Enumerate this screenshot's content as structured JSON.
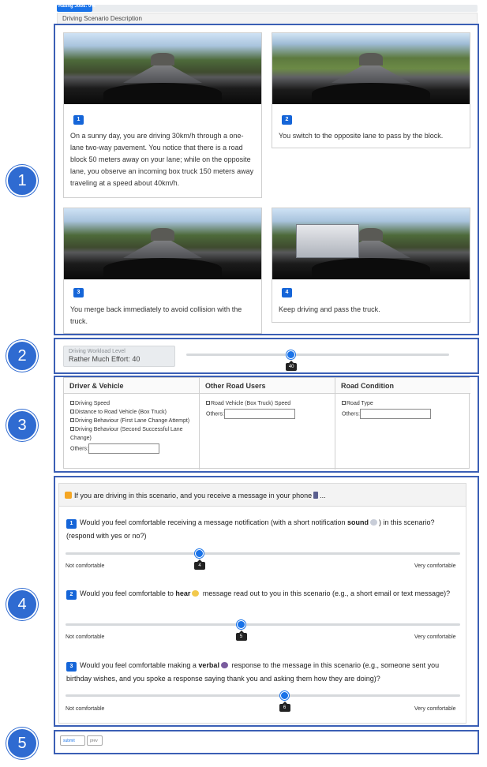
{
  "progress": {
    "label": "Rating Jobs: 0%",
    "value_percent": 0
  },
  "header": {
    "title": "Driving Scenario Description"
  },
  "section_numbers": [
    "1",
    "2",
    "3",
    "4",
    "5"
  ],
  "scenario_cards": [
    {
      "index": "1",
      "text": "On a sunny day, you are driving 30km/h through a one-lane two-way pavement. You notice that there is a road block 50 meters away on your lane; while on the opposite lane, you observe an incoming box truck 150 meters away traveling at a speed about 40km/h."
    },
    {
      "index": "2",
      "text": "You switch to the opposite lane to pass by the block."
    },
    {
      "index": "3",
      "text": "You merge back immediately to avoid collision with the truck."
    },
    {
      "index": "4",
      "text": "Keep driving and pass the truck."
    }
  ],
  "workload": {
    "label": "Driving Workload Level",
    "value_text": "Rather Much Effort: 40",
    "slider_value": 40,
    "slider_label": "40",
    "slider_fraction": 0.4
  },
  "factors": {
    "columns": [
      {
        "title": "Driver & Vehicle",
        "options": [
          "Driving Speed",
          "Distance to Road Vehicle (Box Truck)",
          "Driving Behaviour (First Lane Change Attempt)",
          "Driving Behaviour (Second Successful Lane Change)"
        ],
        "others_label": "Others:"
      },
      {
        "title": "Other Road Users",
        "options": [
          "Road Vehicle (Box Truck) Speed"
        ],
        "others_label": "Others:"
      },
      {
        "title": "Road Condition",
        "options": [
          "Road Type"
        ],
        "others_label": "Others:"
      }
    ]
  },
  "questions": {
    "intro": "If you are driving in this scenario, and you receive a message in your phone",
    "intro_suffix": "...",
    "items": [
      {
        "index": "1",
        "text_before": "Would you feel comfortable receiving a message notification (with a short notification ",
        "bold": "sound",
        "text_after": ") in this scenario? (respond with yes or no?)",
        "value": 4,
        "value_label": "4",
        "fraction": 0.34
      },
      {
        "index": "2",
        "text_before": "Would you feel comfortable to ",
        "bold": "hear",
        "text_after": " message read out to you in this scenario (e.g., a short email or text message)?",
        "value": 5,
        "value_label": "5",
        "fraction": 0.445
      },
      {
        "index": "3",
        "text_before": "Would you feel comfortable making a ",
        "bold": "verbal",
        "text_after": " response to the message in this scenario (e.g., someone sent you birthday wishes, and you spoke a response saying thank you and asking them how they are doing)?",
        "value": 6,
        "value_label": "6",
        "fraction": 0.555
      }
    ],
    "min_label": "Not comfortable",
    "max_label": "Very comfortable"
  },
  "buttons": {
    "submit": "submit",
    "prev": "prev"
  },
  "colors": {
    "accent": "#1a73e8",
    "frame": "#3b5fb5",
    "circle": "#2f6bd1"
  }
}
